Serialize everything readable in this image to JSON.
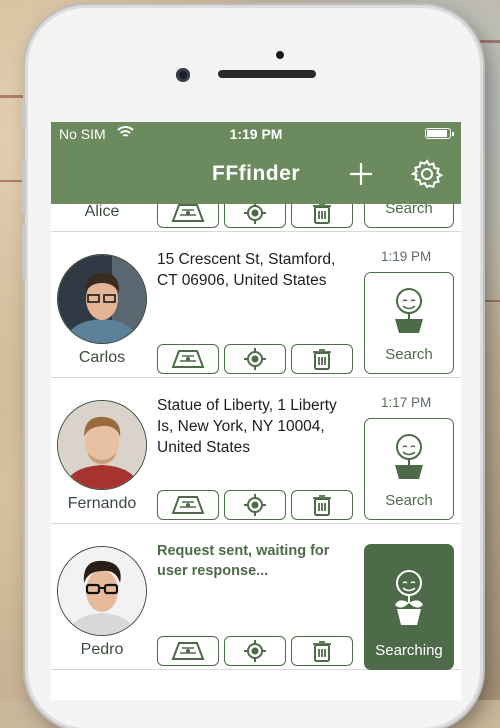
{
  "statusbar": {
    "carrier": "No SIM",
    "time": "1:19 PM",
    "battery": 0.95
  },
  "navbar": {
    "title": "FFfinder",
    "add_icon": "plus-icon",
    "settings_icon": "gear-icon"
  },
  "colors": {
    "brand": "#6b8a5e",
    "accent_dark": "#4d6b48",
    "divider": "#d9d9d9"
  },
  "contacts": [
    {
      "name": "Alice",
      "address": "",
      "time": "",
      "search_label": "Search",
      "status": "idle"
    },
    {
      "name": "Carlos",
      "address": "15 Crescent St, Stamford, CT  06906, United States",
      "time": "1:19 PM",
      "search_label": "Search",
      "status": "idle"
    },
    {
      "name": "Fernando",
      "address": "Statue of Liberty, 1 Liberty Is, New York, NY 10004, United States",
      "time": "1:17 PM",
      "search_label": "Search",
      "status": "idle"
    },
    {
      "name": "Pedro",
      "address": "Request sent, waiting for user response...",
      "time": "",
      "search_label": "Searching",
      "status": "searching"
    }
  ]
}
